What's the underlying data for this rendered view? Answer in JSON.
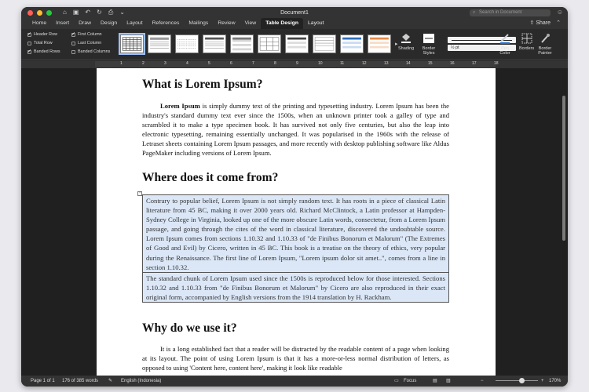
{
  "window": {
    "title": "Document1",
    "search_placeholder": "Search in Document"
  },
  "tabs": [
    "Home",
    "Insert",
    "Draw",
    "Design",
    "Layout",
    "References",
    "Mailings",
    "Review",
    "View",
    "Table Design",
    "Layout"
  ],
  "active_tab": "Table Design",
  "share_label": "Share",
  "table_style_options": [
    {
      "label": "Header Row",
      "checked": true
    },
    {
      "label": "First Column",
      "checked": true
    },
    {
      "label": "Total Row",
      "checked": false
    },
    {
      "label": "Last Column",
      "checked": false
    },
    {
      "label": "Banded Rows",
      "checked": true
    },
    {
      "label": "Banded Columns",
      "checked": false
    }
  ],
  "ribbon_tools": {
    "shading": "Shading",
    "border_styles_1": "Border",
    "border_styles_2": "Styles",
    "pen_weight": "½ pt",
    "pen_color_1": "Pen",
    "pen_color_2": "Color",
    "borders": "Borders",
    "border_painter_1": "Border",
    "border_painter_2": "Painter"
  },
  "ruler_numbers": [
    "1",
    "2",
    "3",
    "4",
    "5",
    "6",
    "7",
    "8",
    "9",
    "10",
    "11",
    "12",
    "13",
    "14",
    "15",
    "16",
    "17",
    "18"
  ],
  "document": {
    "heading1": "What is Lorem Ipsum?",
    "para1_bold": "Lorem Ipsum",
    "para1_rest": " is simply dummy text of the printing and typesetting industry. Lorem Ipsum has been the industry's standard dummy text ever since the 1500s, when an unknown printer took a galley of type and scrambled it to make a type specimen book. It has survived not only five centuries, but also the leap into electronic typesetting, remaining essentially unchanged. It was popularised in the 1960s with the release of Letraset sheets containing Lorem Ipsum passages, and more recently with desktop publishing software like Aldus PageMaker including versions of Lorem Ipsum.",
    "heading2": "Where does it come from?",
    "table_cell1": "Contrary to popular belief, Lorem Ipsum is not simply random text. It has roots in a piece of classical Latin literature from 45 BC, making it over 2000 years old. Richard McClintock, a Latin professor at Hampden-Sydney College in Virginia, looked up one of the more obscure Latin words, consectetur, from a Lorem Ipsum passage, and going through the cites of the word in classical literature, discovered the undoubtable source. Lorem Ipsum comes from sections 1.10.32 and 1.10.33 of \"de Finibus Bonorum et Malorum\" (The Extremes of Good and Evil) by Cicero, written in 45 BC. This book is a treatise on the theory of ethics, very popular during the Renaissance. The first line of Lorem Ipsum, \"Lorem ipsum dolor sit amet..\", comes from a line in section 1.10.32.",
    "table_cell2": "The standard chunk of Lorem Ipsum used since the 1500s is reproduced below for those interested. Sections 1.10.32 and 1.10.33 from \"de Finibus Bonorum et Malorum\" by Cicero are also reproduced in their exact original form, accompanied by English versions from the 1914 translation by H. Rackham.",
    "heading3": "Why do we use it?",
    "para3": "It is a long established fact that a reader will be distracted by the readable content of a page when looking at its layout. The point of using Lorem Ipsum is that it has a more-or-less normal distribution of letters, as opposed to using 'Content here, content here', making it look like readable"
  },
  "status": {
    "page": "Page 1 of 1",
    "words": "176 of 385 words",
    "language": "English (Indonesia)",
    "focus": "Focus",
    "zoom": "170%"
  },
  "colors": {
    "table_fill": "#dbe7f7",
    "close": "#ff5f57",
    "minimize": "#febc2e",
    "maximize": "#28c840"
  }
}
